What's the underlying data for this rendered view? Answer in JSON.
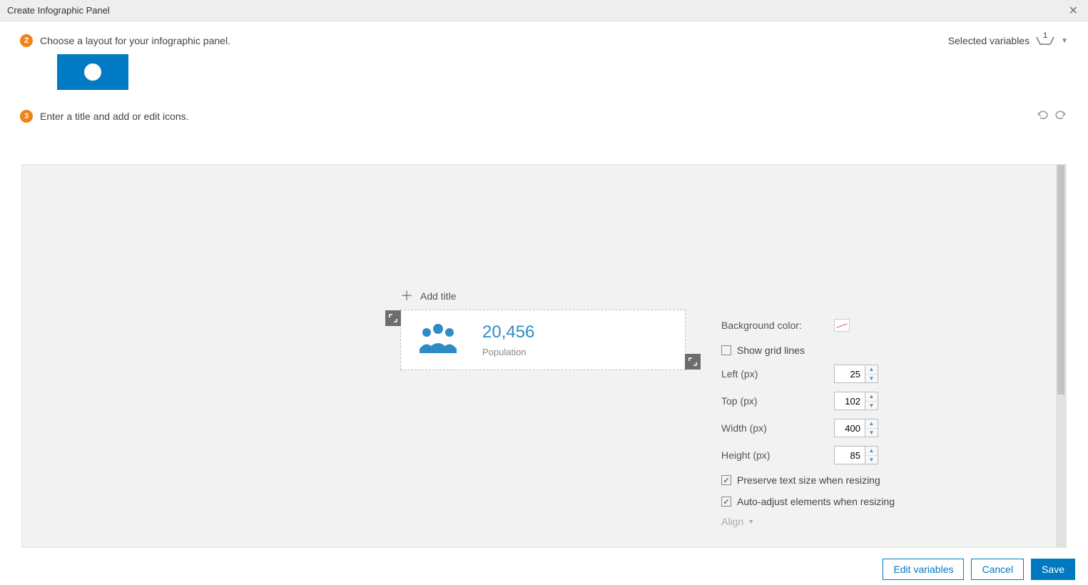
{
  "title": "Create Infographic Panel",
  "step2": {
    "num": "2",
    "text": "Choose a layout for your infographic panel."
  },
  "selectedVars": {
    "label": "Selected variables",
    "count": "1"
  },
  "step3": {
    "num": "3",
    "text": "Enter a title and add or edit icons."
  },
  "addTitle": "Add title",
  "card": {
    "value": "20,456",
    "label": "Population"
  },
  "props": {
    "bgColor": "Background color:",
    "showGrid": {
      "label": "Show grid lines",
      "checked": false
    },
    "left": {
      "label": "Left (px)",
      "value": "25"
    },
    "top": {
      "label": "Top (px)",
      "value": "102"
    },
    "width": {
      "label": "Width (px)",
      "value": "400"
    },
    "height": {
      "label": "Height (px)",
      "value": "85"
    },
    "preserve": {
      "label": "Preserve text size when resizing",
      "checked": true
    },
    "autoAdjust": {
      "label": "Auto-adjust elements when resizing",
      "checked": true
    },
    "align": "Align"
  },
  "footer": {
    "editVars": "Edit variables",
    "cancel": "Cancel",
    "save": "Save"
  }
}
